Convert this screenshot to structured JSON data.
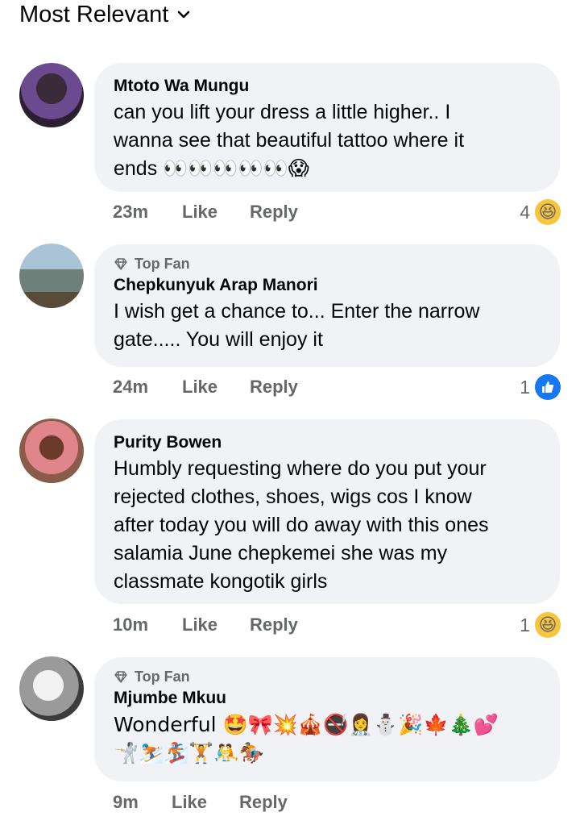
{
  "sort": {
    "label": "Most Relevant"
  },
  "comments": [
    {
      "author": "Mtoto Wa Mungu",
      "badge": "",
      "text": "can you lift your dress a little higher.. I\nwanna see that beautiful tattoo where it\nends 👀👀👀👀👀😱",
      "time": "23m",
      "like_label": "Like",
      "reply_label": "Reply",
      "reaction_count": "4",
      "reaction_icon": "haha-emoji-icon",
      "avatar_colors": [
        "#6b4a8f",
        "#2a2030"
      ]
    },
    {
      "author": "Chepkunyuk Arap Manori",
      "badge": "Top Fan",
      "text": "I wish get a chance to... Enter the narrow\ngate..... You will enjoy it",
      "time": "24m",
      "like_label": "Like",
      "reply_label": "Reply",
      "reaction_count": "1",
      "reaction_icon": "thumbs-up-icon",
      "avatar_colors": [
        "#9bb7c8",
        "#5c6d6a"
      ]
    },
    {
      "author": "Purity Bowen",
      "badge": "",
      "text": "Humbly requesting where do you put your\nrejected clothes, shoes, wigs  cos I know\nafter today you will do away with this ones\nsalamia June chepkemei she was my\nclassmate kongotik girls",
      "time": "10m",
      "like_label": "Like",
      "reply_label": "Reply",
      "reaction_count": "1",
      "reaction_icon": "haha-emoji-icon",
      "avatar_colors": [
        "#d7837a",
        "#5a3a2a"
      ]
    },
    {
      "author": "Mjumbe Mkuu",
      "badge": "Top Fan",
      "text": "Wonderful 🤩🎀💥🎪🚭👩‍⚕️⛄🎉🍁🎄💕\n🤺⛷️🏂🏋️🤼🏇",
      "time": "9m",
      "like_label": "Like",
      "reply_label": "Reply",
      "reaction_count": "",
      "reaction_icon": "",
      "avatar_colors": [
        "#c8c8c8",
        "#4a4a4a"
      ]
    }
  ]
}
